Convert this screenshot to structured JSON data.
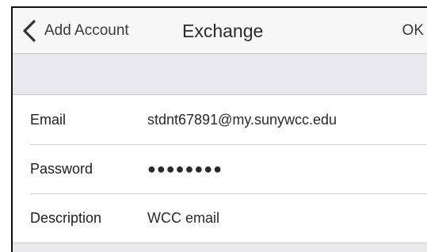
{
  "navbar": {
    "back_label": "Add Account",
    "title": "Exchange",
    "ok_label": "OK"
  },
  "form": {
    "rows": [
      {
        "label": "Email",
        "value": "stdnt67891@my.sunywcc.edu"
      },
      {
        "label": "Password",
        "value": "●●●●●●●●"
      },
      {
        "label": "Description",
        "value": "WCC email"
      }
    ]
  },
  "icons": {
    "back": "chevron-left-icon"
  },
  "colors": {
    "navbar_bg": "#f7f7f7",
    "group_bg": "#e9e9ed",
    "cell_bg": "#ffffff",
    "separator": "#d5d5d9"
  }
}
